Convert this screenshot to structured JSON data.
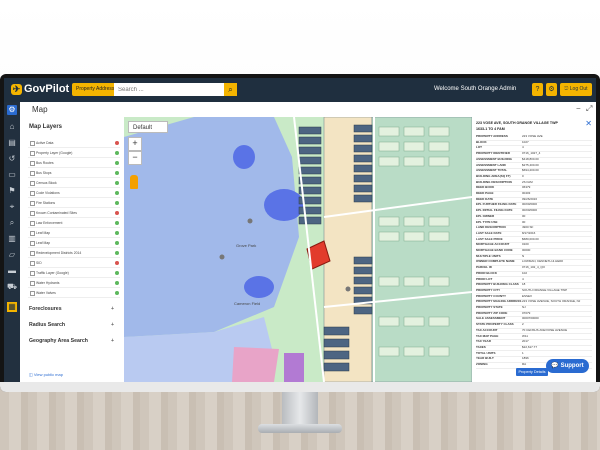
{
  "app": {
    "logo_text": "GovPilot",
    "property_dropdown": "Property Address ▾",
    "search_placeholder": "Search ...",
    "welcome": "Welcome South Orange Admin",
    "logout": "Log Out",
    "accent_color": "#f4b400",
    "nav_color": "#1f2f3f"
  },
  "map_header": {
    "title": "Map"
  },
  "layers_panel": {
    "title": "Map Layers",
    "layers": [
      {
        "label": "Active Data",
        "status_color": "#d9534f"
      },
      {
        "label": "Property Layer (Google)",
        "status_color": "#5cb85c"
      },
      {
        "label": "Bus Routes",
        "status_color": "#5cb85c"
      },
      {
        "label": "Bus Stops",
        "status_color": "#5cb85c"
      },
      {
        "label": "Census Block",
        "status_color": "#5cb85c"
      },
      {
        "label": "Code Violations",
        "status_color": "#5cb85c"
      },
      {
        "label": "Fire Stations",
        "status_color": "#5cb85c"
      },
      {
        "label": "Known Contaminated Sites",
        "status_color": "#d9534f"
      },
      {
        "label": "Law Enforcement",
        "status_color": "#5cb85c"
      },
      {
        "label": "Leaf Map",
        "status_color": "#5cb85c"
      },
      {
        "label": "Leaf Map",
        "status_color": "#5cb85c"
      },
      {
        "label": "Redevelopment Districts 2014",
        "status_color": "#5cb85c"
      },
      {
        "label": "SID",
        "status_color": "#d9534f"
      },
      {
        "label": "Traffic Layer (Google)",
        "status_color": "#5cb85c"
      },
      {
        "label": "Water Hydrants",
        "status_color": "#5cb85c"
      },
      {
        "label": "Water Valves",
        "status_color": "#5cb85c"
      }
    ],
    "sections": [
      "Foreclosures",
      "Radius Search",
      "Geography Area Search"
    ],
    "public_map_link": "View public map"
  },
  "map": {
    "basemap": "Default",
    "labels": [
      "Grove Park",
      "Cameron Field"
    ]
  },
  "details": {
    "address": "223 VOSE AVE, SOUTH ORANGE VILLAGE TWP",
    "subtitle": "1633-1 TO 4 FAM",
    "rows": [
      {
        "k": "Property Address",
        "v": "223 VOSE AVE"
      },
      {
        "k": "Block",
        "v": "1027"
      },
      {
        "k": "Lot",
        "v": "4"
      },
      {
        "k": "Property Identifier",
        "v": "0716_1027_4"
      },
      {
        "k": "Assessment Building",
        "v": "$418,800.00"
      },
      {
        "k": "Assessment Land",
        "v": "$275,400.00"
      },
      {
        "k": "Assessment Total",
        "v": "$694,200.00"
      },
      {
        "k": "Building Area(Sq ft)",
        "v": "0"
      },
      {
        "k": "Building Description",
        "v": "2S FAM"
      },
      {
        "k": "Deed Book",
        "v": "06379"
      },
      {
        "k": "Deed Page",
        "v": "00403"
      },
      {
        "k": "Deed Date",
        "v": "09/26/2016"
      },
      {
        "k": "EPL Further Filing Date",
        "v": "00/00/0000"
      },
      {
        "k": "EPL Initial Filing Date",
        "v": "00/00/0000"
      },
      {
        "k": "EPL Owner",
        "v": "00"
      },
      {
        "k": "EPL Type Use",
        "v": "00"
      },
      {
        "k": "Land Description",
        "v": "4900 SF"
      },
      {
        "k": "Last Sale Date",
        "v": "8/17/2016"
      },
      {
        "k": "Last Sale Price",
        "v": "$680,000.00"
      },
      {
        "k": "Mortgage Account",
        "v": "0100"
      },
      {
        "k": "Mortgage Bank Code",
        "v": "00000"
      },
      {
        "k": "Multiple Units",
        "v": "N"
      },
      {
        "k": "Owner Complete Name",
        "v": "LOWMAN, KENNETH & HEIDI"
      },
      {
        "k": "Parcel ID",
        "v": "0716_102_4_QO"
      },
      {
        "k": "Prior Block",
        "v": "102"
      },
      {
        "k": "Prior Lot",
        "v": "4"
      },
      {
        "k": "Property Building Class",
        "v": "18"
      },
      {
        "k": "Property City",
        "v": "SOUTH ORANGE VILLAGE TWP"
      },
      {
        "k": "Property County",
        "v": "ESSEX"
      },
      {
        "k": "Property Mailing Address",
        "v": "223 VOSE AVENUE, SOUTH ORANGE, NJ"
      },
      {
        "k": "Property State",
        "v": "NJ"
      },
      {
        "k": "Property Zip Code",
        "v": "07079"
      },
      {
        "k": "Sale Assessment",
        "v": "0000700000"
      },
      {
        "k": "State Property Class",
        "v": "2"
      },
      {
        "k": "Tax Account",
        "v": "70 CENSUS AVE/VOSE AVENUE"
      },
      {
        "k": "Tax Map Page",
        "v": "W11"
      },
      {
        "k": "Tax Year",
        "v": "2017"
      },
      {
        "k": "Taxes",
        "v": "$22,617.77"
      },
      {
        "k": "Total Units",
        "v": "1"
      },
      {
        "k": "Year Built",
        "v": "1896"
      },
      {
        "k": "Zoning",
        "v": "RA"
      }
    ],
    "button": "Property Details"
  },
  "support": {
    "label": "Support"
  }
}
